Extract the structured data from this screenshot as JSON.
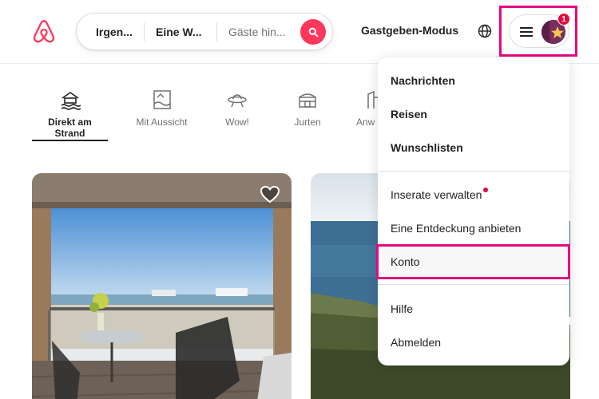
{
  "header": {
    "logo_icon": "airbnb-logo-icon",
    "search": {
      "where": "Irgen...",
      "when": "Eine W...",
      "who": "Gäste hin...",
      "button_icon": "search-icon"
    },
    "host_mode": "Gastgeben-Modus",
    "globe_icon": "globe-icon",
    "menu_icon": "hamburger-icon",
    "notification_count": "1"
  },
  "categories": [
    {
      "label": "Direkt am Strand",
      "icon": "beach-icon",
      "active": true
    },
    {
      "label": "Mit Aussicht",
      "icon": "view-icon",
      "active": false
    },
    {
      "label": "Wow!",
      "icon": "ufo-icon",
      "active": false
    },
    {
      "label": "Jurten",
      "icon": "yurt-icon",
      "active": false
    },
    {
      "label": "Anw",
      "icon": "countryside-icon",
      "active": false
    }
  ],
  "menu": {
    "items": [
      {
        "label": "Nachrichten"
      },
      {
        "label": "Reisen"
      },
      {
        "label": "Wunschlisten"
      },
      {
        "label": "Inserate verwalten"
      },
      {
        "label": "Eine Entdeckung anbieten"
      },
      {
        "label": "Konto"
      },
      {
        "label": "Hilfe"
      },
      {
        "label": "Abmelden"
      }
    ]
  },
  "colors": {
    "brand": "#ff385c",
    "highlight": "#e6087f",
    "badge": "#e00b41"
  }
}
